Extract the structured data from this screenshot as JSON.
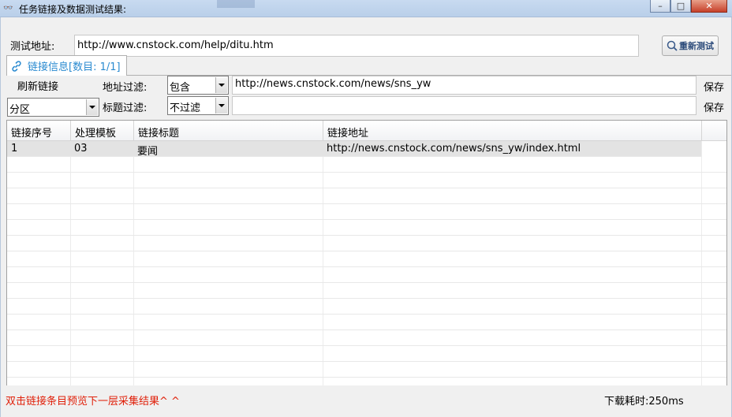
{
  "window": {
    "title": "任务链接及数据测试结果:",
    "minimize": "–",
    "maximize": "□",
    "close": "✕"
  },
  "test": {
    "label": "测试地址:",
    "url": "http://www.cnstock.com/help/ditu.htm",
    "retest_button": "重新测试"
  },
  "tab": {
    "label": "链接信息[数目: 1/1]"
  },
  "filters": {
    "refresh_button": "刷新链接",
    "section_combo": "分区",
    "address_filter_label": "地址过滤:",
    "address_filter_mode": "包含",
    "address_filter_value": "http://news.cnstock.com/news/sns_yw",
    "title_filter_label": "标题过滤:",
    "title_filter_mode": "不过滤",
    "title_filter_value": "",
    "save_label_1": "保存",
    "save_label_2": "保存"
  },
  "table": {
    "columns": [
      "链接序号",
      "处理模板",
      "链接标题",
      "链接地址"
    ],
    "rows": [
      [
        "1",
        "03",
        "要闻",
        "http://news.cnstock.com/news/sns_yw/index.html"
      ]
    ]
  },
  "status": {
    "hint": "双击链接条目预览下一层采集结果^ ^",
    "timing": "下载耗时:250ms"
  },
  "colors": {
    "tab_text": "#2a8ad0",
    "hint_text": "#e0200a",
    "selected_row": "#e3e3e3"
  }
}
